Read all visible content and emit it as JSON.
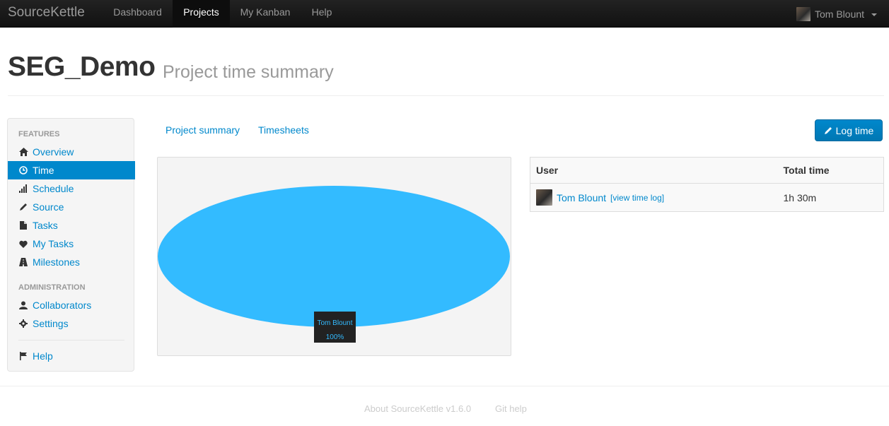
{
  "navbar": {
    "brand": "SourceKettle",
    "items": [
      {
        "label": "Dashboard",
        "active": false
      },
      {
        "label": "Projects",
        "active": true
      },
      {
        "label": "My Kanban",
        "active": false
      },
      {
        "label": "Help",
        "active": false
      }
    ],
    "user": {
      "name": "Tom Blount",
      "avatar": "user-avatar"
    }
  },
  "header": {
    "title": "SEG_Demo",
    "subtitle": "Project time summary"
  },
  "sidebar": {
    "sections": [
      {
        "title": "FEATURES",
        "items": [
          {
            "label": "Overview",
            "icon": "home-icon",
            "active": false
          },
          {
            "label": "Time",
            "icon": "clock-icon",
            "active": true
          },
          {
            "label": "Schedule",
            "icon": "signal-icon",
            "active": false
          },
          {
            "label": "Source",
            "icon": "pencil-icon",
            "active": false
          },
          {
            "label": "Tasks",
            "icon": "file-icon",
            "active": false
          },
          {
            "label": "My Tasks",
            "icon": "heart-icon",
            "active": false
          },
          {
            "label": "Milestones",
            "icon": "road-icon",
            "active": false
          }
        ]
      },
      {
        "title": "ADMINISTRATION",
        "items": [
          {
            "label": "Collaborators",
            "icon": "user-icon",
            "active": false
          },
          {
            "label": "Settings",
            "icon": "cog-icon",
            "active": false
          }
        ]
      }
    ],
    "footer_item": {
      "label": "Help",
      "icon": "flag-icon"
    }
  },
  "tabs": [
    {
      "label": "Project summary"
    },
    {
      "label": "Timesheets"
    }
  ],
  "actions": {
    "log_time_label": "Log time",
    "log_time_icon": "pencil-icon"
  },
  "chart_data": {
    "type": "pie",
    "slices": [
      {
        "label": "Tom Blount",
        "value": 100,
        "color": "#33bbff"
      }
    ],
    "tooltip": {
      "name": "Tom Blount",
      "percent": "100%"
    }
  },
  "table": {
    "headers": {
      "user": "User",
      "total_time": "Total time"
    },
    "rows": [
      {
        "user": "Tom Blount",
        "view_link": "[view time log]",
        "total_time": "1h 30m"
      }
    ]
  },
  "footer": {
    "about": "About SourceKettle v1.6.0",
    "git_help": "Git help"
  },
  "colors": {
    "accent": "#0088cc",
    "pie": "#33bbff",
    "navbar": "#1b1b1b"
  }
}
